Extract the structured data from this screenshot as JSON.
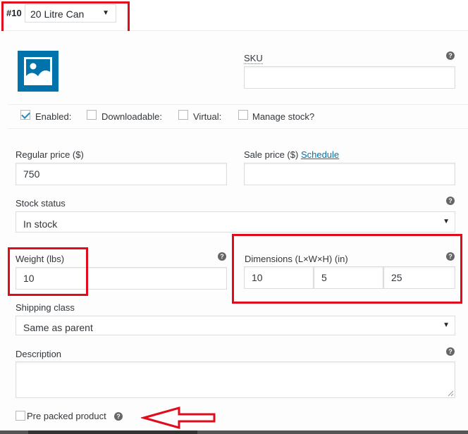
{
  "variation": {
    "number": "#10",
    "selected": "20 Litre Can",
    "dropdown_icon": "chevron-down-icon"
  },
  "image": {
    "icon": "image-placeholder-icon",
    "color": "#0073aa"
  },
  "sku": {
    "label": "SKU",
    "value": ""
  },
  "options": {
    "enabled": {
      "label": "Enabled:",
      "checked": true
    },
    "downloadable": {
      "label": "Downloadable:",
      "checked": false
    },
    "virtual": {
      "label": "Virtual:",
      "checked": false
    },
    "manage_stock": {
      "label": "Manage stock?",
      "checked": false
    }
  },
  "pricing": {
    "regular_label": "Regular price ($)",
    "regular_value": "750",
    "sale_label": "Sale price ($)",
    "schedule_link": "Schedule",
    "sale_value": ""
  },
  "stock": {
    "label": "Stock status",
    "selected": "In stock"
  },
  "weight": {
    "label": "Weight (lbs)",
    "value": "10"
  },
  "dimensions": {
    "label": "Dimensions (L×W×H) (in)",
    "length": "10",
    "width": "5",
    "height": "25"
  },
  "shipping": {
    "label": "Shipping class",
    "selected": "Same as parent"
  },
  "description": {
    "label": "Description",
    "value": ""
  },
  "prepacked": {
    "label": "Pre packed product",
    "checked": false
  },
  "help_glyph": "?",
  "dropdown_glyph": "▼",
  "annotation_color": "#e00b1c"
}
